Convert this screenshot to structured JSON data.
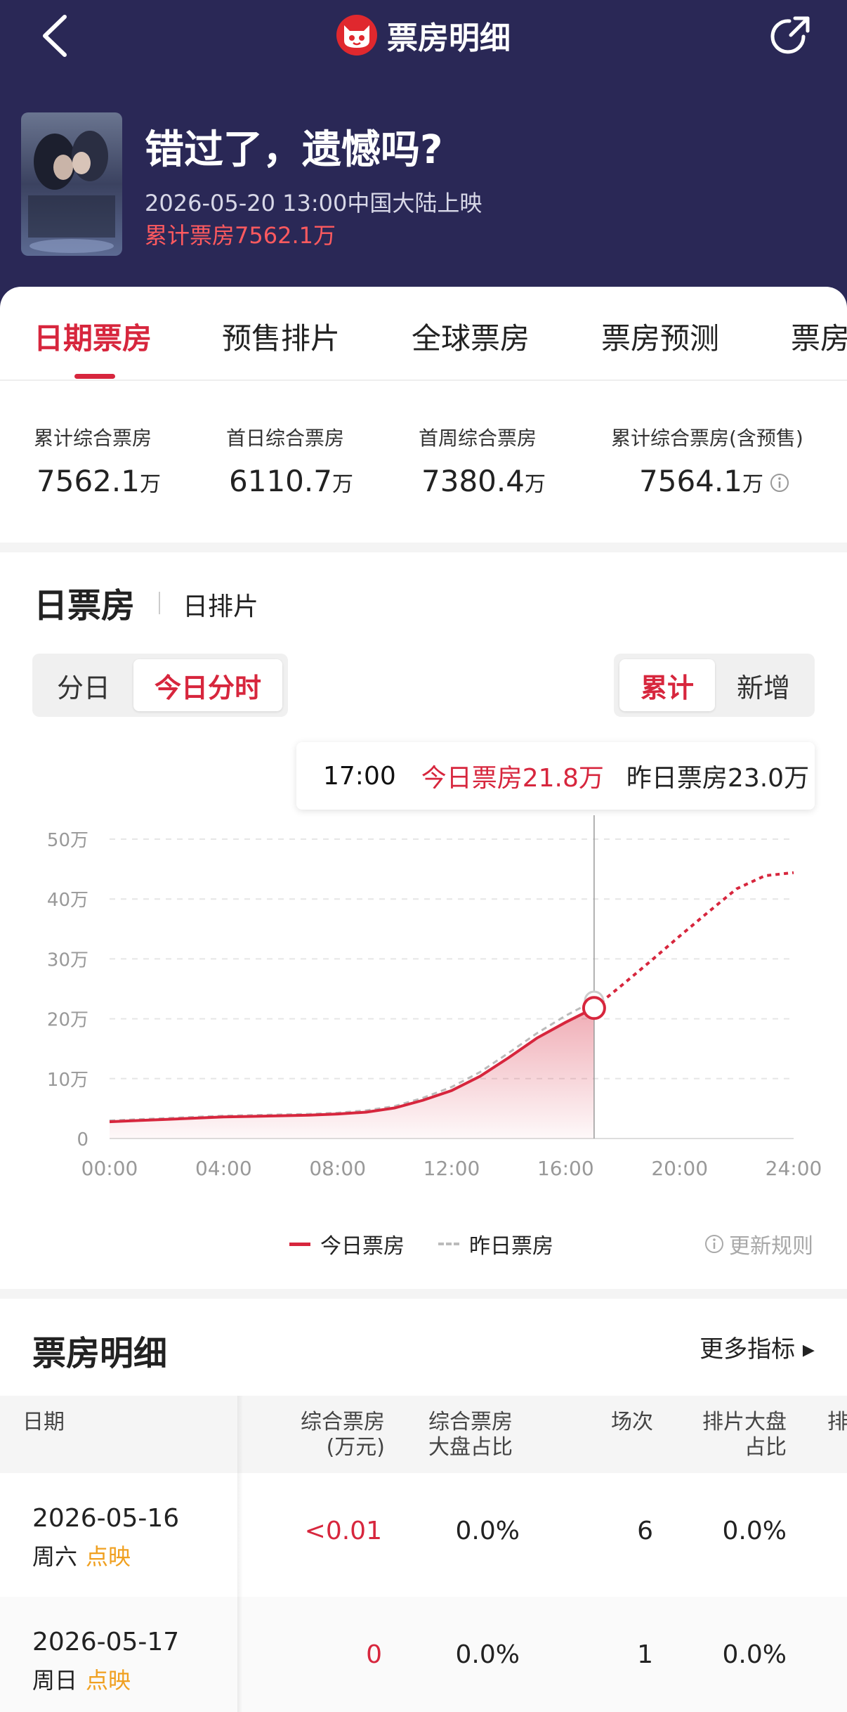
{
  "nav": {
    "title": "票房明细",
    "back_icon": "chevron-left-icon",
    "share_icon": "share-icon",
    "logo_icon": "cat-logo-icon",
    "colors": {
      "header_bg": "#2a2856",
      "accent": "#d7263d",
      "logo": "#e0282e"
    }
  },
  "movie": {
    "title": "错过了，遗憾吗?",
    "release": "2026-05-20 13:00中国大陆上映",
    "cumulative": "累计票房7562.1万"
  },
  "tabs": [
    {
      "label": "日期票房",
      "active": true
    },
    {
      "label": "预售排片"
    },
    {
      "label": "全球票房"
    },
    {
      "label": "票房预测"
    },
    {
      "label": "票房"
    }
  ],
  "stats": [
    {
      "label": "累计综合票房",
      "value": "7562.1",
      "unit": "万"
    },
    {
      "label": "首日综合票房",
      "value": "6110.7",
      "unit": "万"
    },
    {
      "label": "首周综合票房",
      "value": "7380.4",
      "unit": "万"
    },
    {
      "label": "累计综合票房(含预售)",
      "value": "7564.1",
      "unit": "万"
    }
  ],
  "daily": {
    "title": "日票房",
    "subtitle": "日排片",
    "mode_tabs": [
      "分日",
      "今日分时"
    ],
    "active_mode": "今日分时",
    "metric_tabs": [
      "累计",
      "新增"
    ],
    "active_metric": "累计"
  },
  "tooltip": {
    "time": "17:00",
    "today": "今日票房21.8万",
    "yesterday": "昨日票房23.0万"
  },
  "chart_data": {
    "type": "line",
    "x_ticks": [
      "00:00",
      "04:00",
      "08:00",
      "12:00",
      "16:00",
      "20:00",
      "24:00"
    ],
    "y_ticks": [
      "0",
      "10万",
      "20万",
      "30万",
      "40万",
      "50万"
    ],
    "ylim": [
      0,
      50
    ],
    "xlim": [
      0,
      24
    ],
    "grid": true,
    "legend_position": "bottom",
    "highlight_x": 17,
    "series": [
      {
        "name": "今日票房",
        "color": "#d7263d",
        "style": "solid",
        "fill": true,
        "points": [
          [
            0,
            2.8
          ],
          [
            1,
            3.0
          ],
          [
            2,
            3.2
          ],
          [
            3,
            3.4
          ],
          [
            4,
            3.6
          ],
          [
            5,
            3.7
          ],
          [
            6,
            3.8
          ],
          [
            7,
            3.9
          ],
          [
            8,
            4.1
          ],
          [
            9,
            4.4
          ],
          [
            10,
            5.1
          ],
          [
            11,
            6.4
          ],
          [
            12,
            8.0
          ],
          [
            13,
            10.4
          ],
          [
            14,
            13.5
          ],
          [
            15,
            16.8
          ],
          [
            16,
            19.4
          ],
          [
            17,
            21.8
          ]
        ]
      },
      {
        "name": "昨日票房",
        "color": "#bbbbbb",
        "style": "dashed",
        "points": [
          [
            0,
            3.0
          ],
          [
            1,
            3.2
          ],
          [
            2,
            3.4
          ],
          [
            3,
            3.6
          ],
          [
            4,
            3.8
          ],
          [
            5,
            3.9
          ],
          [
            6,
            4.0
          ],
          [
            7,
            4.1
          ],
          [
            8,
            4.3
          ],
          [
            9,
            4.7
          ],
          [
            10,
            5.4
          ],
          [
            11,
            6.8
          ],
          [
            12,
            8.6
          ],
          [
            13,
            11.1
          ],
          [
            14,
            14.3
          ],
          [
            15,
            17.6
          ],
          [
            16,
            20.5
          ],
          [
            17,
            23.0
          ]
        ]
      },
      {
        "name": "today-forecast",
        "color": "#d7263d",
        "style": "dotted",
        "points": [
          [
            17,
            21.8
          ],
          [
            18,
            25.7
          ],
          [
            19,
            29.7
          ],
          [
            20,
            33.8
          ],
          [
            21,
            37.8
          ],
          [
            22,
            41.7
          ],
          [
            23,
            43.9
          ],
          [
            24,
            44.4
          ]
        ]
      }
    ]
  },
  "legend": {
    "today": "今日票房",
    "yesterday": "昨日票房",
    "update_rules": "更新规则"
  },
  "detail": {
    "title": "票房明细",
    "more": "更多指标 ▸",
    "columns": [
      {
        "line1": "日期",
        "line2": ""
      },
      {
        "line1": "综合票房",
        "line2": "(万元)"
      },
      {
        "line1": "综合票房",
        "line2": "大盘占比"
      },
      {
        "line1": "场次",
        "line2": ""
      },
      {
        "line1": "排片大盘",
        "line2": "占比"
      },
      {
        "line1": "排",
        "line2": ""
      }
    ],
    "rows": [
      {
        "date": "2026-05-16",
        "weekday": "周六",
        "badge": "点映",
        "box": "<0.01",
        "share": "0.0%",
        "shows": "6",
        "schedule_share": "0.0%"
      },
      {
        "date": "2026-05-17",
        "weekday": "周日",
        "badge": "点映",
        "box": "0",
        "share": "0.0%",
        "shows": "1",
        "schedule_share": "0.0%"
      }
    ]
  }
}
